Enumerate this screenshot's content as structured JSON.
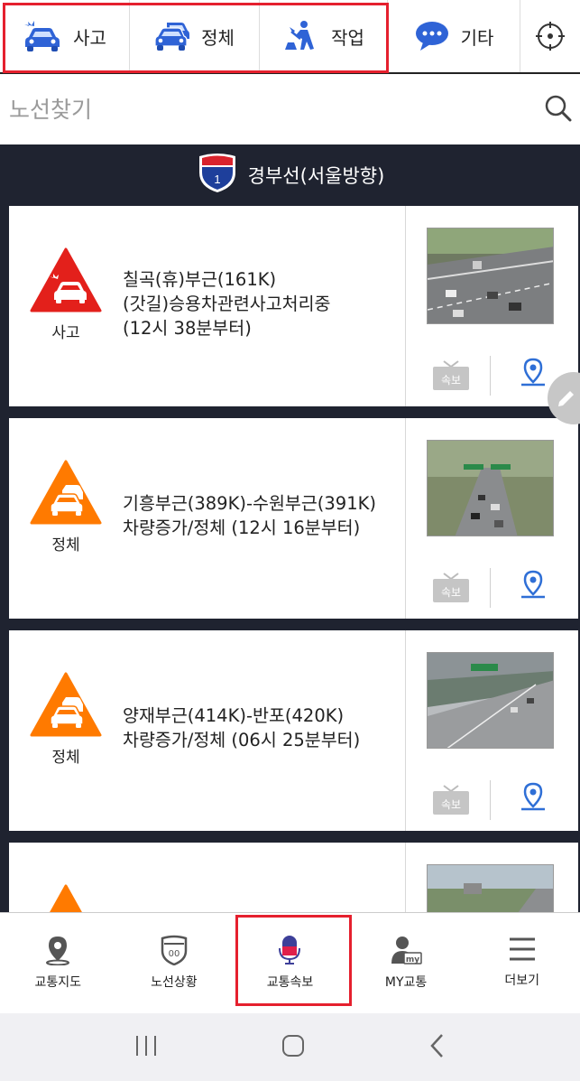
{
  "top_tabs": [
    {
      "label": "사고",
      "icon": "car-crash-icon"
    },
    {
      "label": "정체",
      "icon": "traffic-jam-icon"
    },
    {
      "label": "작업",
      "icon": "roadwork-icon"
    },
    {
      "label": "기타",
      "icon": "chat-bubble-icon"
    }
  ],
  "locate_icon": "crosshair-icon",
  "search": {
    "placeholder": "노선찾기"
  },
  "route": {
    "number": "1",
    "name": "경부선(서울방향)"
  },
  "incidents": [
    {
      "category": "사고",
      "severity_color": "#e3201b",
      "lines": [
        "칠곡(휴)부근(161K)",
        "(갓길)승용차관련사고처리중",
        "(12시 38분부터)"
      ]
    },
    {
      "category": "정체",
      "severity_color": "#ff7a00",
      "lines": [
        "기흥부근(389K)-수원부근(391K)",
        "차량증가/정체 (12시 16분부터)"
      ]
    },
    {
      "category": "정체",
      "severity_color": "#ff7a00",
      "lines": [
        "양재부근(414K)-반포(420K)",
        "차량증가/정체 (06시 25분부터)"
      ]
    },
    {
      "category": "",
      "severity_color": "#ff7a00",
      "lines": []
    }
  ],
  "card_actions": {
    "flash_label": "속보"
  },
  "bottom_nav": [
    {
      "label": "교통지도",
      "icon": "map-pin-icon"
    },
    {
      "label": "노선상황",
      "icon": "route-shield-icon"
    },
    {
      "label": "교통속보",
      "icon": "microphone-icon"
    },
    {
      "label": "MY교통",
      "icon": "my-user-icon"
    },
    {
      "label": "더보기",
      "icon": "menu-icon"
    }
  ]
}
